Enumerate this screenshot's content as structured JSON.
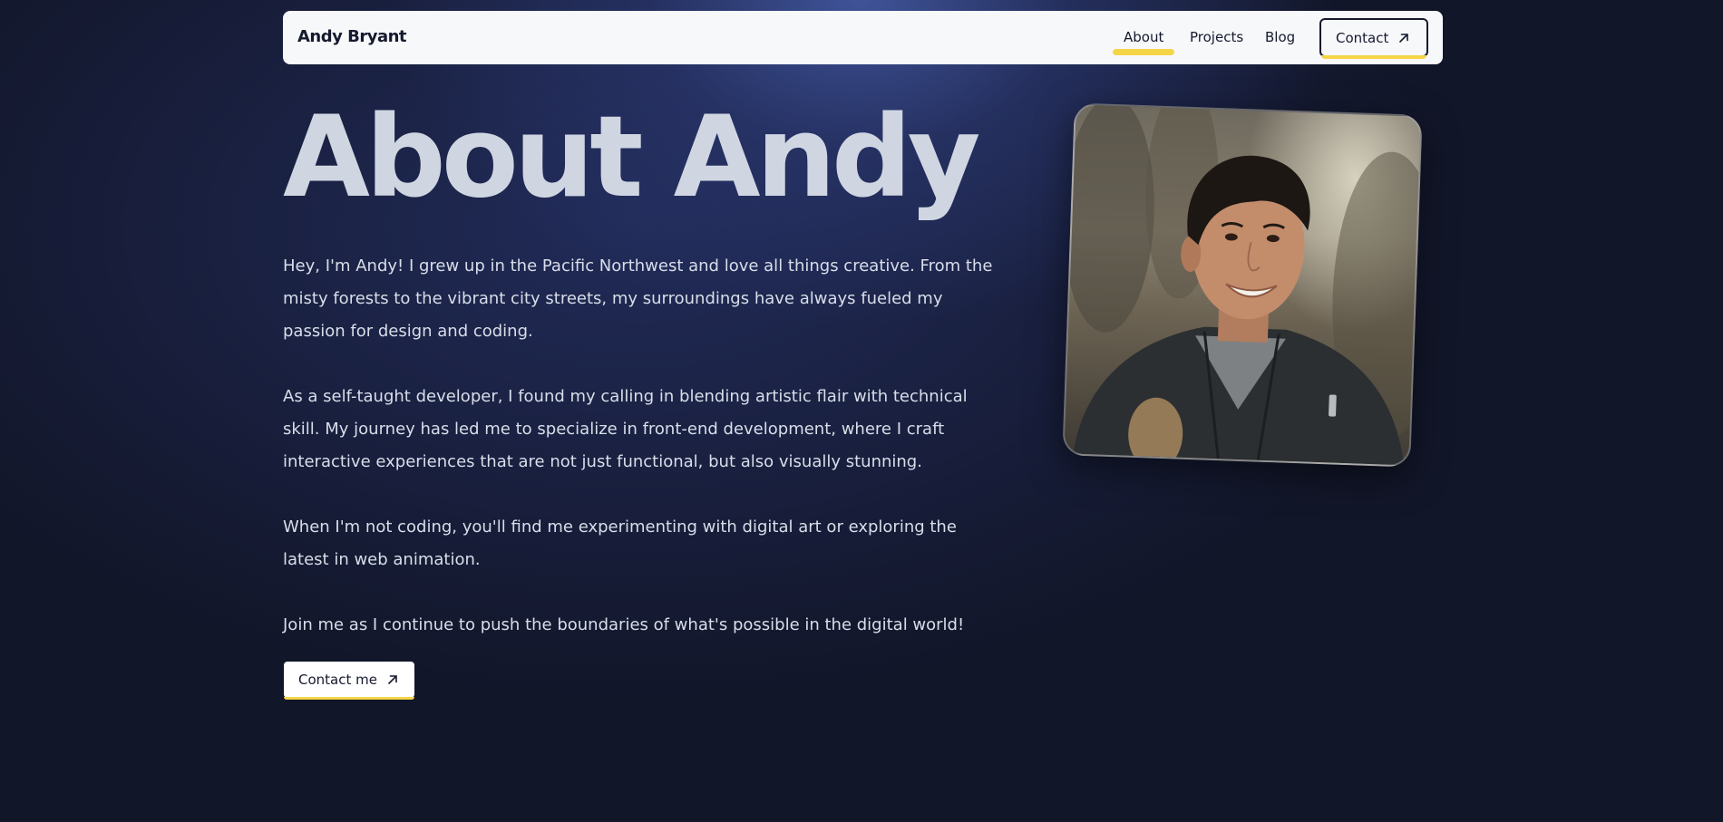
{
  "nav": {
    "brand": "Andy Bryant",
    "links": [
      {
        "label": "About",
        "active": true
      },
      {
        "label": "Projects",
        "active": false
      },
      {
        "label": "Blog",
        "active": false
      }
    ],
    "contact_label": "Contact"
  },
  "hero": {
    "title": "About Andy",
    "paragraphs": [
      "Hey, I'm Andy! I grew up in the Pacific Northwest and love all things creative. From the misty forests to the vibrant city streets, my surroundings have always fueled my passion for design and coding.",
      "As a self-taught developer, I found my calling in blending artistic flair with technical skill. My journey has led me to specialize in front-end development, where I craft interactive experiences that are not just functional, but also visually stunning.",
      "When I'm not coding, you'll find me experimenting with digital art or exploring the latest in web animation.",
      "Join me as I continue to push the boundaries of what's possible in the digital world!"
    ],
    "cta_label": "Contact me"
  },
  "colors": {
    "accent": "#f5d547",
    "background": "#121629",
    "title": "#cfd6e2",
    "body_text": "#d8dee9",
    "nav_bg": "#f7f8fa"
  },
  "icons": {
    "nav_contact": "arrow-up-right-icon",
    "cta": "arrow-up-right-icon"
  }
}
